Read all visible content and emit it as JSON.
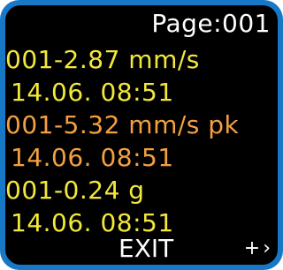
{
  "header": {
    "page_label": "Page:001"
  },
  "records": [
    {
      "value": "001-2.87 mm/s",
      "timestamp": "14.06. 08:51",
      "color": "#f3e83a"
    },
    {
      "value": "001-5.32 mm/s pk",
      "timestamp": "14.06. 08:51",
      "color": "#f3a042"
    },
    {
      "value": "001-0.24 g",
      "timestamp": "14.06. 08:51",
      "color": "#f3e83a"
    }
  ],
  "footer": {
    "exit_label": "EXIT",
    "nav_plus": "+",
    "nav_arrow": "›"
  },
  "colors": {
    "frame": "#1878c8",
    "background": "#000000",
    "text": "#ffffff"
  }
}
